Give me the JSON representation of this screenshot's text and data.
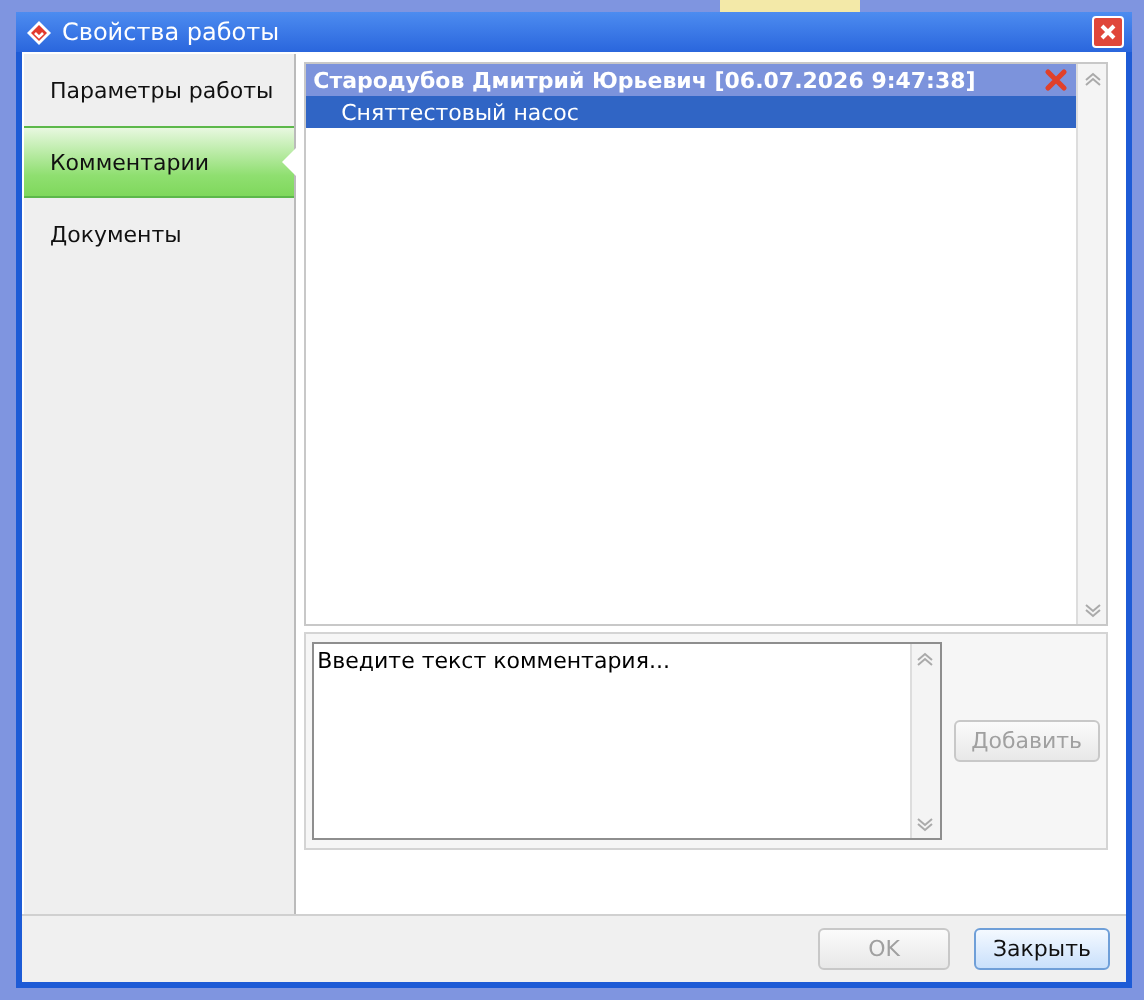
{
  "window": {
    "title": "Свойства работы"
  },
  "sidebar": {
    "items": [
      {
        "label": "Параметры работы",
        "selected": false
      },
      {
        "label": "Комментарии",
        "selected": true
      },
      {
        "label": "Документы",
        "selected": false
      }
    ]
  },
  "comments": [
    {
      "author": "Стародубов Дмитрий Юрьевич [06.07.2026 9:47:38]",
      "text": "Сняттестовый насос",
      "selected": true
    }
  ],
  "comment_input": {
    "placeholder": "Введите текст комментария..."
  },
  "add_button": {
    "label": "Добавить",
    "disabled": true
  },
  "buttons": [
    {
      "label": "OK",
      "disabled": true
    },
    {
      "label": "Закрыть",
      "disabled": false
    }
  ]
}
